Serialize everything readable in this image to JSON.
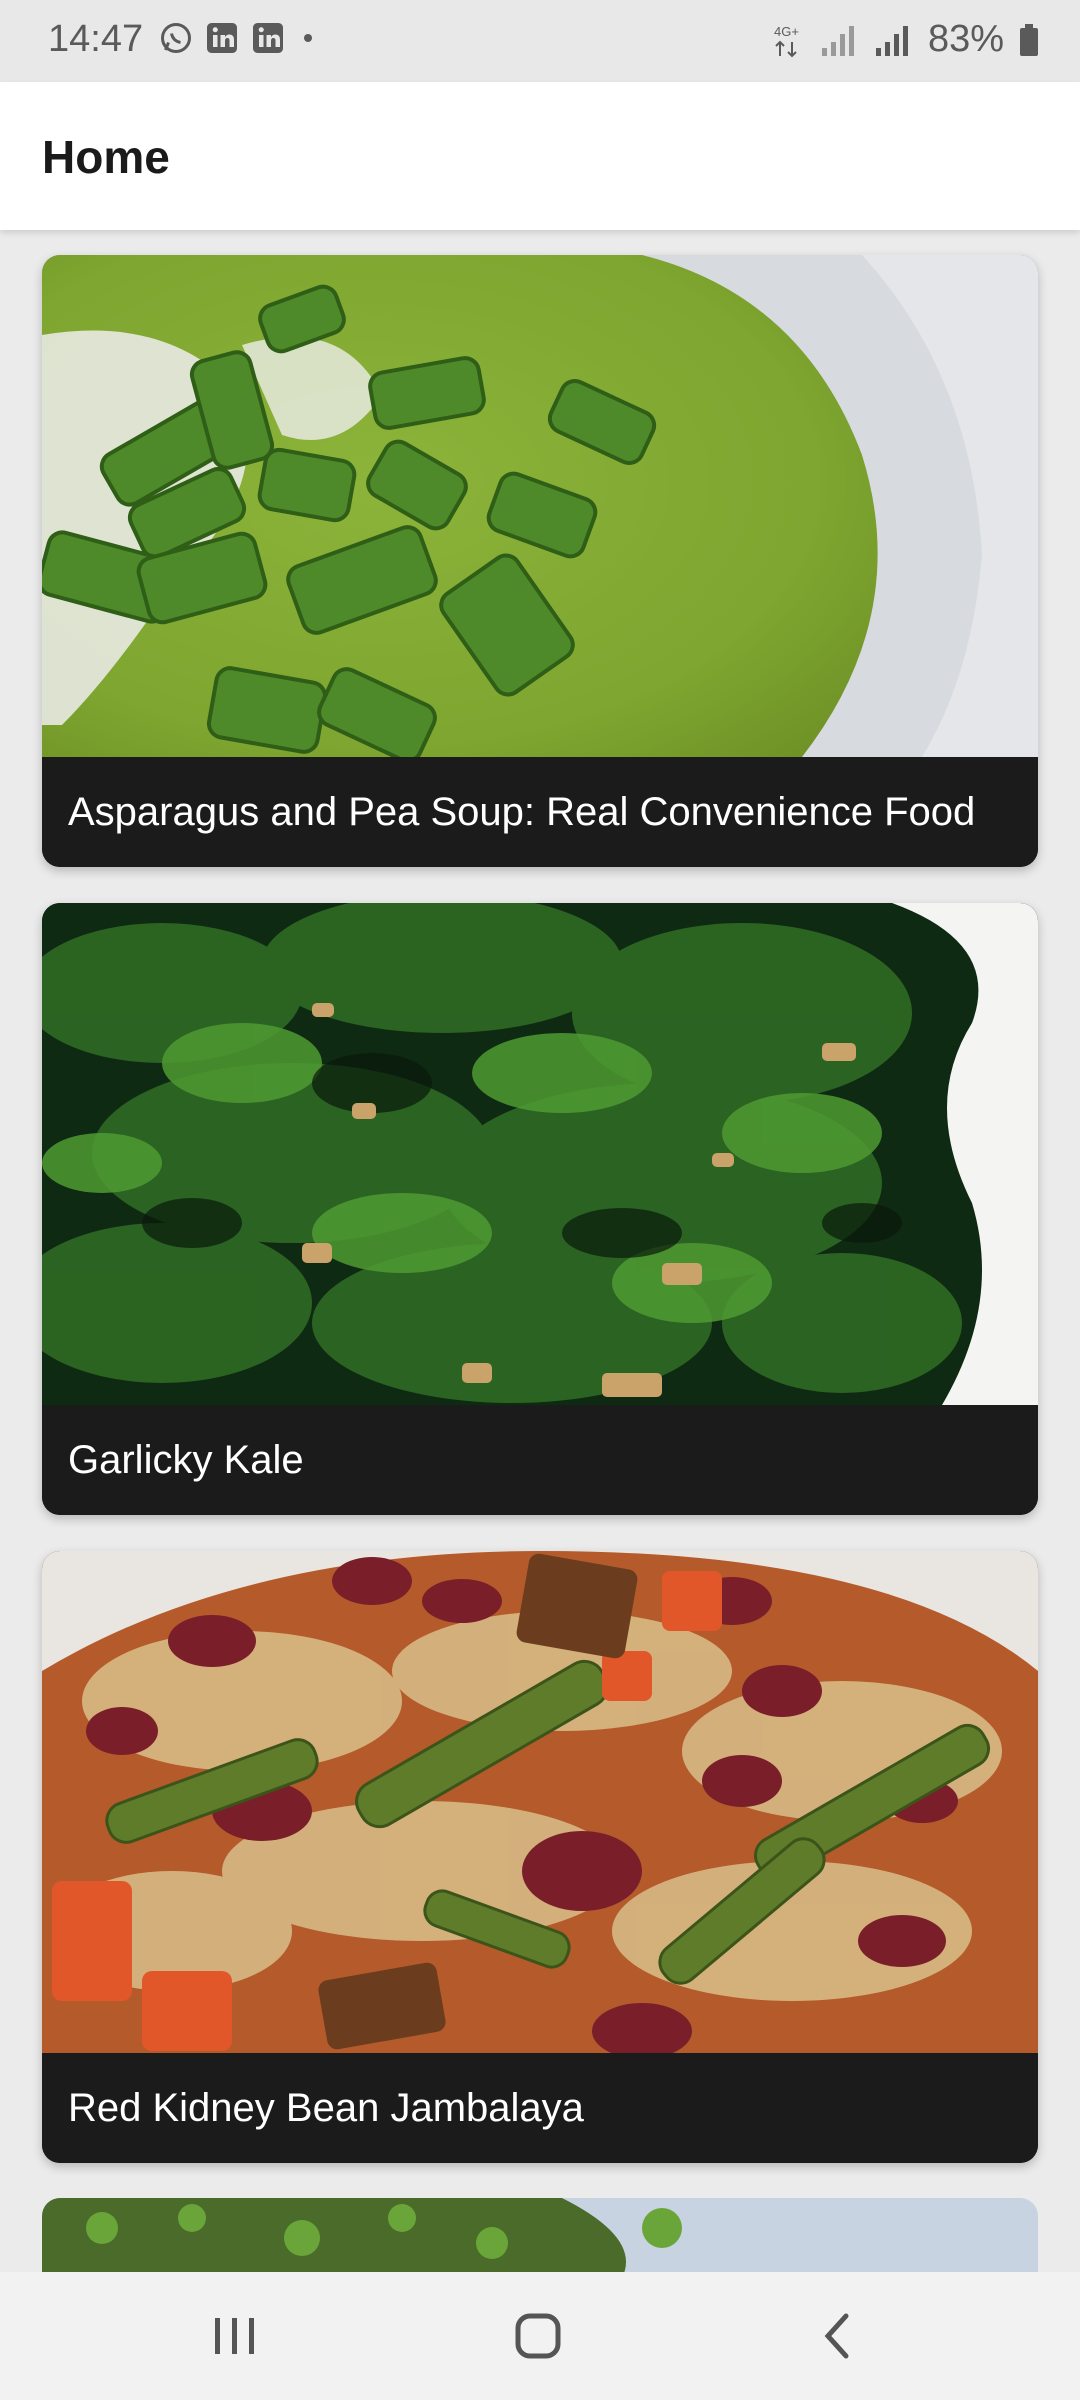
{
  "status_bar": {
    "time": "14:47",
    "battery": "83%",
    "network": "4G+",
    "icons": [
      "whatsapp-icon",
      "linkedin-icon",
      "linkedin-icon",
      "dot-icon"
    ]
  },
  "app_bar": {
    "title": "Home"
  },
  "recipes": [
    {
      "title": "Asparagus and Pea Soup: Real Convenience Food",
      "image": "green-soup-with-chives"
    },
    {
      "title": "Garlicky Kale",
      "image": "sauteed-kale-with-garlic"
    },
    {
      "title": "Red Kidney Bean Jambalaya",
      "image": "bean-jambalaya-bowl"
    }
  ],
  "nav_bar": {
    "buttons": [
      "recent-apps-icon",
      "home-icon",
      "back-icon"
    ]
  }
}
